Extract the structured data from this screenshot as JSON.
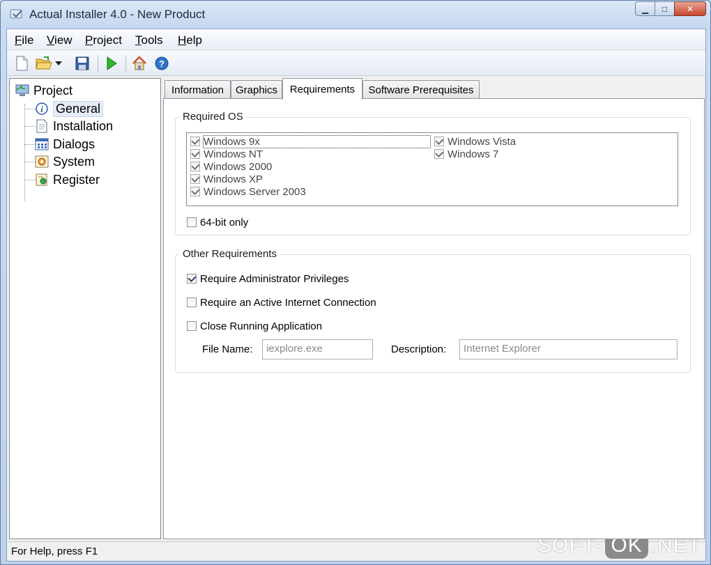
{
  "window": {
    "title": "Actual Installer 4.0 - New Product",
    "minimize_glyph": "▁",
    "maximize_glyph": "□",
    "close_glyph": "✕"
  },
  "menu": [
    {
      "accel": "F",
      "rest": "ile"
    },
    {
      "accel": "V",
      "rest": "iew"
    },
    {
      "accel": "P",
      "rest": "roject"
    },
    {
      "accel": "T",
      "rest": "ools"
    },
    {
      "accel": "H",
      "rest": "elp"
    }
  ],
  "toolbar_icons": [
    "new-file-icon",
    "open-folder-icon",
    "dropdown-arrow-icon",
    "save-icon",
    "run-icon",
    "home-icon",
    "help-icon"
  ],
  "tree": {
    "root": "Project",
    "children": [
      "General",
      "Installation",
      "Dialogs",
      "System",
      "Register"
    ],
    "selected": "General"
  },
  "tabs": [
    "Information",
    "Graphics",
    "Requirements",
    "Software Prerequisites"
  ],
  "active_tab": "Requirements",
  "required_os": {
    "title": "Required OS",
    "column1": [
      {
        "label": "Windows 9x",
        "checked": true
      },
      {
        "label": "Windows NT",
        "checked": true
      },
      {
        "label": "Windows 2000",
        "checked": true
      },
      {
        "label": "Windows XP",
        "checked": true
      },
      {
        "label": "Windows Server 2003",
        "checked": true
      }
    ],
    "column2": [
      {
        "label": "Windows Vista",
        "checked": true
      },
      {
        "label": "Windows 7",
        "checked": true
      }
    ],
    "bit64_label": "64-bit only",
    "bit64_checked": false
  },
  "other_requirements": {
    "title": "Other Requirements",
    "admin_label": "Require Administrator Privileges",
    "admin_checked": true,
    "internet_label": "Require an Active Internet Connection",
    "internet_checked": false,
    "close_app_label": "Close Running Application",
    "close_app_checked": false,
    "file_name_label": "File Name:",
    "file_name_value": "iexplore.exe",
    "description_label": "Description:",
    "description_value": "Internet Explorer"
  },
  "status": "For Help, press F1",
  "watermark": {
    "left": "SOFT-",
    "mid": "OK",
    "right": ".NET"
  }
}
